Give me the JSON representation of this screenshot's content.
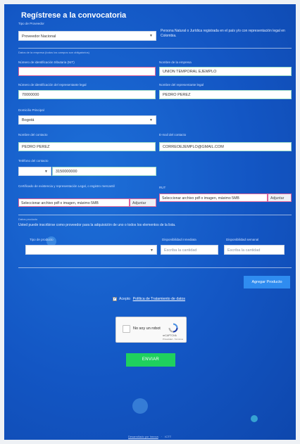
{
  "form": {
    "title": "Regístrese a la convocatoria",
    "provider_type_label": "Tipo de Proveedor",
    "provider_type_value": "Proveedor Nacional",
    "provider_type_info": "Persona Natural o Jurídica registrada en el país y/o con representación legal en Colombia.",
    "company_section_label": "Datos de la empresa (todos los campos son obligatorios)",
    "nit_label": "Número de identificación tributaria (NIT)",
    "nit_value": "",
    "company_name_label": "Nombre de la empresa",
    "company_name_value": "UNION TEMPORAL EJEMPLO",
    "legal_id_label": "Número de identificación del representante legal",
    "legal_id_value": "70000000",
    "legal_name_label": "Nombre del representante legal",
    "legal_name_value": "PEDRO PEREZ",
    "address_label": "Domicilio Principal",
    "address_value": "Bogotá",
    "contact_name_label": "Nombre del contacto",
    "contact_name_value": "PEDRO PEREZ",
    "email_label": "E-mail del contacto",
    "email_value": "CORREOEJEMPLO@GMAIL.COM",
    "phone_label": "Teléfono del contacto",
    "phone_prefix_value": "",
    "phone_value": "3150000000",
    "certificate_label": "Certificado de existencia y representación Legal, o registro mercantil",
    "certificate_placeholder": "Seleccionar archivo pdf o imagen, máximo 5MB",
    "attach_label": "Adjuntar",
    "rut_label": "RUT",
    "rut_placeholder": "Seleccionar archivo pdf o imagen, máximo 5MB",
    "product_section_label": "Datos producto",
    "product_intro": "Usted puede inscribirse como proveedor para la adquisición de uno o todos los elementos de la lista.",
    "product_type_label": "Tipo de producto",
    "product_type_value": "",
    "immediate_label": "Disponibilidad inmediata",
    "immediate_placeholder": "Escriba la cantidad",
    "weekly_label": "Disponibilidad semanal",
    "weekly_placeholder": "Escriba la cantidad",
    "add_product_label": "Agregar Producto",
    "accept_text": "Acepto",
    "policy_link": "Política de Tratamiento de datos",
    "captcha_text": "No soy un robot",
    "captcha_brand": "reCAPTCHA",
    "captcha_links": "Privacidad - Términos",
    "send_label": "ENVIAR",
    "footer_left": "Desarrollado por Innova",
    "footer_right": "ICTT"
  },
  "colors": {
    "panel": "#1356c4",
    "send_button": "#1fd15e",
    "add_button": "#2f8cf0",
    "error_border": "#e0629a"
  }
}
